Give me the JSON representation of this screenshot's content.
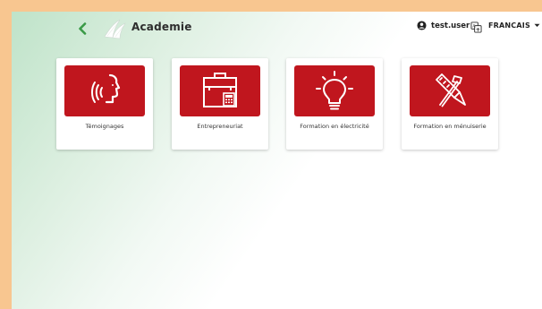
{
  "header": {
    "app_title": "Academie",
    "user_name": "test.user",
    "language": "FRANCAIS"
  },
  "cards": [
    {
      "label": "Témoignages",
      "icon": "speaking-head-icon"
    },
    {
      "label": "Entrepreneuriat",
      "icon": "toolbox-calculator-icon"
    },
    {
      "label": "Formation en électricité",
      "icon": "light-bulb-icon"
    },
    {
      "label": "Formation en ménuiserie",
      "icon": "carpentry-tools-icon"
    }
  ],
  "colors": {
    "accent_red": "#c0161e",
    "back_green": "#3a9a47",
    "frame_orange": "#f8c690"
  }
}
